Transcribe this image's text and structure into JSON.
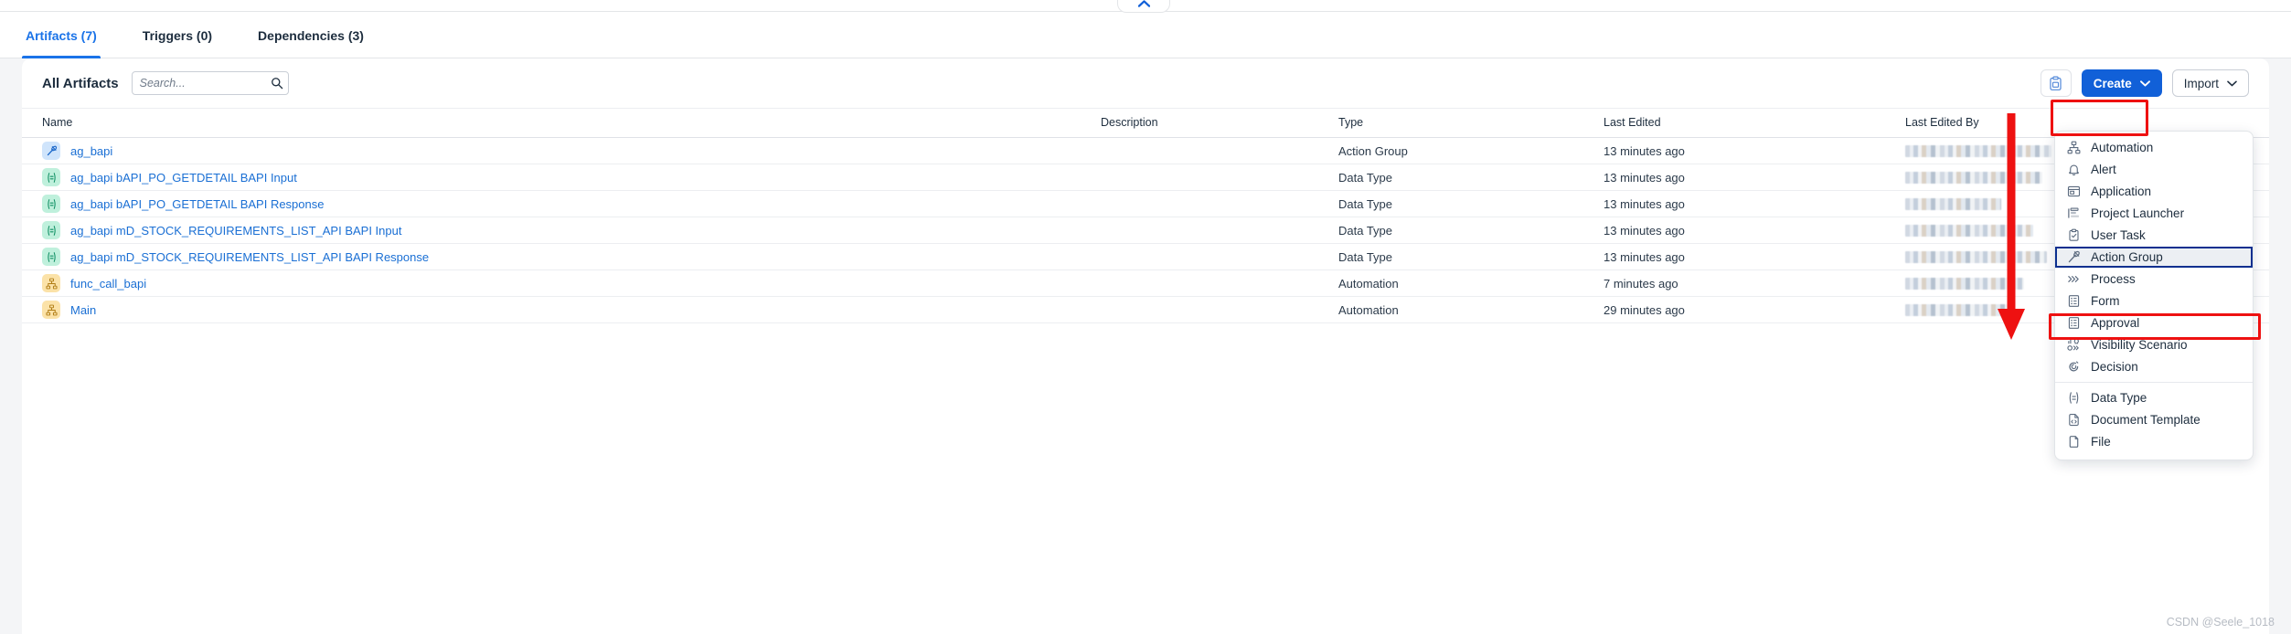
{
  "window": {
    "collapse_button_icon": "chevron-up-icon"
  },
  "tabs": [
    {
      "label": "Artifacts (7)",
      "active": true
    },
    {
      "label": "Triggers (0)",
      "active": false
    },
    {
      "label": "Dependencies (3)",
      "active": false
    }
  ],
  "toolbar": {
    "title": "All Artifacts",
    "search_placeholder": "Search...",
    "search_value": "",
    "search_icon": "search-icon",
    "clipboard_icon": "clipboard-icon",
    "create_label": "Create",
    "import_label": "Import",
    "create_color": "#1160d8"
  },
  "table": {
    "headers": [
      "Name",
      "Description",
      "Type",
      "Last Edited",
      "Last Edited By"
    ],
    "rows": [
      {
        "name": "ag_bapi",
        "icon": "action-group-icon",
        "badge": "badge-actiongroup",
        "description": "",
        "type": "Action Group",
        "last_edited": "13 minutes ago",
        "last_edited_by": "[redacted]"
      },
      {
        "name": "ag_bapi bAPI_PO_GETDETAIL BAPI Input",
        "icon": "data-type-icon",
        "badge": "badge-datatype",
        "description": "",
        "type": "Data Type",
        "last_edited": "13 minutes ago",
        "last_edited_by": "[redacted]"
      },
      {
        "name": "ag_bapi bAPI_PO_GETDETAIL BAPI Response",
        "icon": "data-type-icon",
        "badge": "badge-datatype",
        "description": "",
        "type": "Data Type",
        "last_edited": "13 minutes ago",
        "last_edited_by": "[redacted]"
      },
      {
        "name": "ag_bapi mD_STOCK_REQUIREMENTS_LIST_API BAPI Input",
        "icon": "data-type-icon",
        "badge": "badge-datatype",
        "description": "",
        "type": "Data Type",
        "last_edited": "13 minutes ago",
        "last_edited_by": "[redacted]"
      },
      {
        "name": "ag_bapi mD_STOCK_REQUIREMENTS_LIST_API BAPI Response",
        "icon": "data-type-icon",
        "badge": "badge-datatype",
        "description": "",
        "type": "Data Type",
        "last_edited": "13 minutes ago",
        "last_edited_by": "[redacted]"
      },
      {
        "name": "func_call_bapi",
        "icon": "automation-icon",
        "badge": "badge-automation",
        "description": "",
        "type": "Automation",
        "last_edited": "7 minutes ago",
        "last_edited_by": "[redacted]"
      },
      {
        "name": "Main",
        "icon": "automation-icon",
        "badge": "badge-automation",
        "description": "",
        "type": "Automation",
        "last_edited": "29 minutes ago",
        "last_edited_by": "[redacted]"
      }
    ]
  },
  "create_menu": {
    "items": [
      {
        "label": "Automation",
        "icon": "automation-icon",
        "selected": false,
        "separator_after": false
      },
      {
        "label": "Alert",
        "icon": "bell-icon",
        "selected": false,
        "separator_after": false
      },
      {
        "label": "Application",
        "icon": "application-window-icon",
        "selected": false,
        "separator_after": false
      },
      {
        "label": "Project Launcher",
        "icon": "project-launcher-icon",
        "selected": false,
        "separator_after": false
      },
      {
        "label": "User Task",
        "icon": "clipboard-check-icon",
        "selected": false,
        "separator_after": false
      },
      {
        "label": "Action Group",
        "icon": "action-group-icon",
        "selected": true,
        "separator_after": false
      },
      {
        "label": "Process",
        "icon": "process-icon",
        "selected": false,
        "separator_after": false
      },
      {
        "label": "Form",
        "icon": "form-icon",
        "selected": false,
        "separator_after": false
      },
      {
        "label": "Approval",
        "icon": "approval-icon",
        "selected": false,
        "separator_after": false
      },
      {
        "label": "Visibility Scenario",
        "icon": "visibility-scenario-icon",
        "selected": false,
        "separator_after": false
      },
      {
        "label": "Decision",
        "icon": "decision-icon",
        "selected": false,
        "separator_after": true
      },
      {
        "label": "Data Type",
        "icon": "data-type-icon",
        "selected": false,
        "separator_after": false
      },
      {
        "label": "Document Template",
        "icon": "document-template-icon",
        "selected": false,
        "separator_after": false
      },
      {
        "label": "File",
        "icon": "file-icon",
        "selected": false,
        "separator_after": false
      }
    ]
  },
  "annotations": {
    "highlight_color": "#ee1111",
    "create_box_target": "Create",
    "action_group_box_target": "Action Group",
    "arrow_icon": "red-down-arrow"
  },
  "watermark": "CSDN @Seele_1018"
}
